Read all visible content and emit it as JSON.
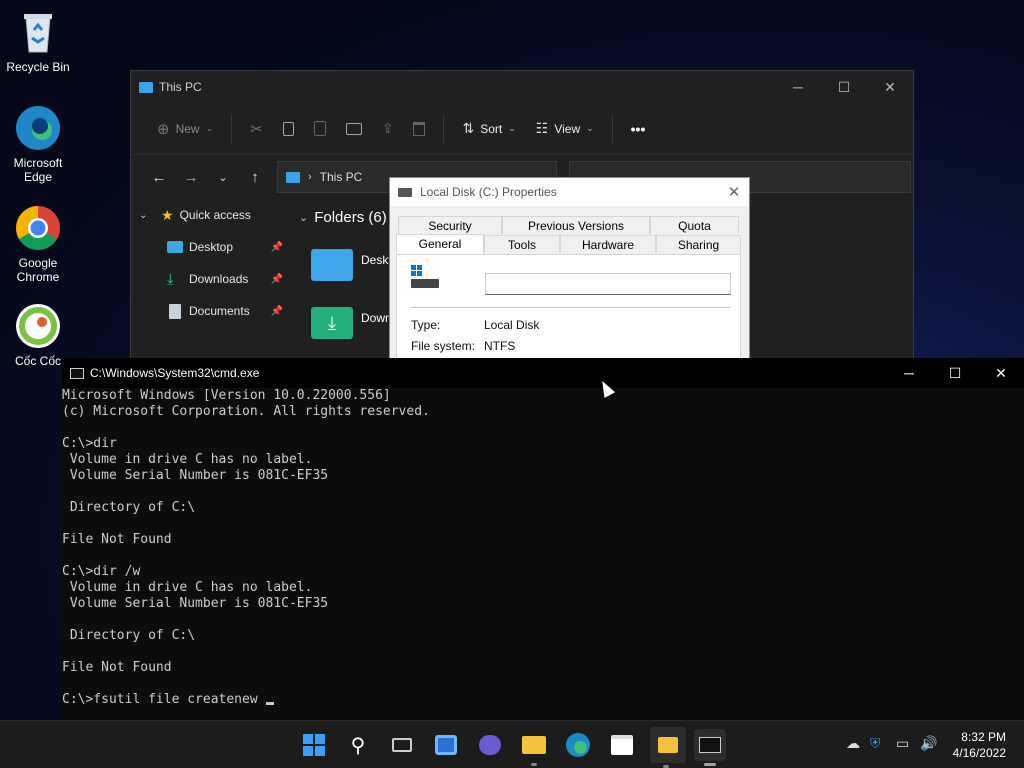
{
  "desktop": {
    "icons": [
      {
        "label": "Recycle Bin"
      },
      {
        "label": "Microsoft Edge"
      },
      {
        "label": "Google Chrome"
      },
      {
        "label": "Cốc Cốc"
      }
    ]
  },
  "explorer": {
    "title": "This PC",
    "toolbar": {
      "new": "New",
      "sort": "Sort",
      "view": "View",
      "more": "•••"
    },
    "address": "This PC",
    "nav": [
      {
        "label": "Quick access"
      },
      {
        "label": "Desktop"
      },
      {
        "label": "Downloads"
      },
      {
        "label": "Documents"
      }
    ],
    "folders_header": "Folders (6)",
    "folders": [
      {
        "label": "Deskt"
      },
      {
        "label": "Down"
      }
    ]
  },
  "properties": {
    "title": "Local Disk (C:) Properties",
    "tabs_row1": [
      "Security",
      "Previous Versions",
      "Quota"
    ],
    "tabs_row2": [
      "General",
      "Tools",
      "Hardware",
      "Sharing"
    ],
    "type_label": "Type:",
    "type_value": "Local Disk",
    "fs_label": "File system:",
    "fs_value": "NTFS"
  },
  "cmd": {
    "title": "C:\\Windows\\System32\\cmd.exe",
    "lines": [
      "Microsoft Windows [Version 10.0.22000.556]",
      "(c) Microsoft Corporation. All rights reserved.",
      "",
      "C:\\>dir",
      " Volume in drive C has no label.",
      " Volume Serial Number is 081C-EF35",
      "",
      " Directory of C:\\",
      "",
      "File Not Found",
      "",
      "C:\\>dir /w",
      " Volume in drive C has no label.",
      " Volume Serial Number is 081C-EF35",
      "",
      " Directory of C:\\",
      "",
      "File Not Found",
      "",
      "C:\\>fsutil file createnew "
    ]
  },
  "taskbar": {
    "time": "8:32 PM",
    "date": "4/16/2022"
  },
  "colors": {
    "accent": "#0078d4",
    "folder": "#3ba7e8"
  }
}
